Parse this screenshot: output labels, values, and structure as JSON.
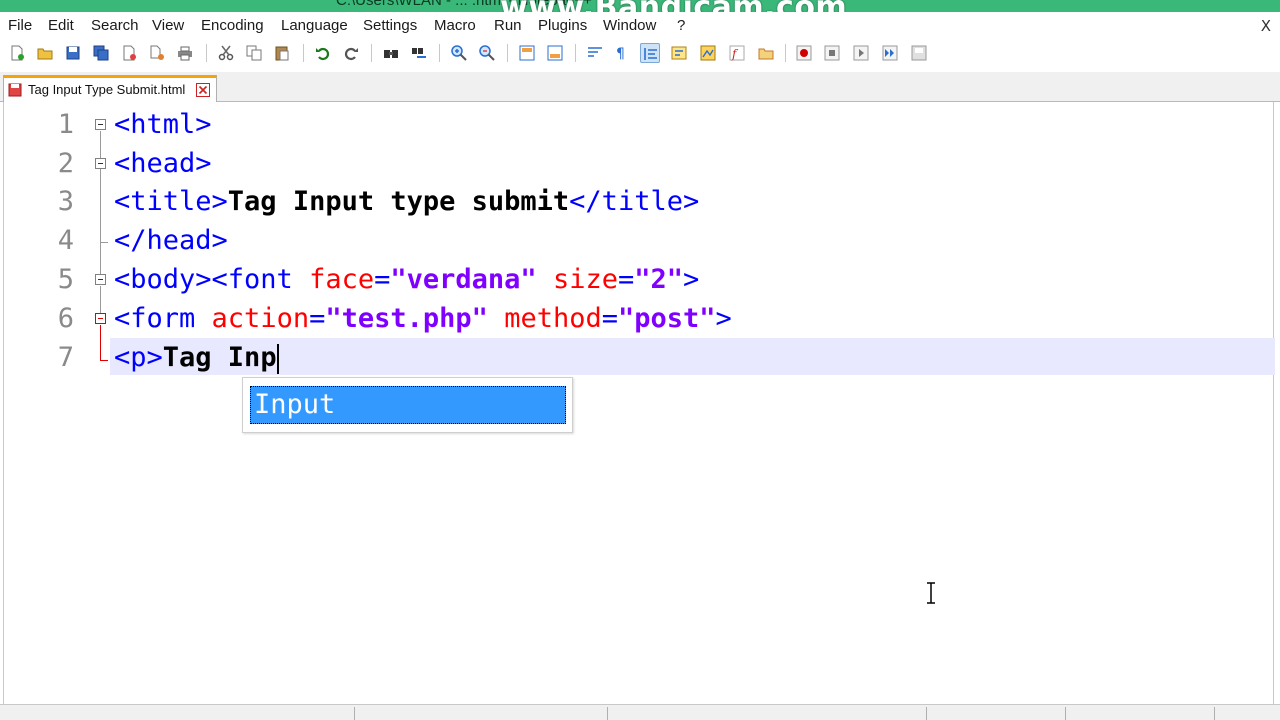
{
  "window": {
    "title": "C:\\Users\\WLAN - ... .html - Notepad++",
    "watermark": "www.Bandicam.com"
  },
  "menu": {
    "items": [
      "File",
      "Edit",
      "Search",
      "View",
      "Encoding",
      "Language",
      "Settings",
      "Macro",
      "Run",
      "Plugins",
      "Window",
      "?"
    ],
    "close_label": "X"
  },
  "toolbar": {
    "icons": [
      "new-file-icon",
      "open-file-icon",
      "save-icon",
      "save-all-icon",
      "close-icon",
      "close-all-icon",
      "print-icon",
      "cut-icon",
      "copy-icon",
      "paste-icon",
      "undo-icon",
      "redo-icon",
      "find-icon",
      "replace-icon",
      "zoom-in-icon",
      "zoom-out-icon",
      "sync-vertical-icon",
      "sync-horizontal-icon",
      "word-wrap-icon",
      "show-all-characters-icon",
      "indent-guide-icon",
      "user-language-icon",
      "doc-map-icon",
      "function-list-icon",
      "folder-workspace-icon",
      "record-macro-icon",
      "stop-record-icon",
      "playback-macro-icon",
      "run-macro-multiple-icon",
      "save-macro-icon"
    ]
  },
  "tab": {
    "label": "Tag Input Type Submit.html",
    "accent_color": "#f4a30b"
  },
  "editor": {
    "lines": [
      {
        "no": "1",
        "segments": [
          {
            "cls": "t-tag",
            "text": "<html>"
          }
        ]
      },
      {
        "no": "2",
        "segments": [
          {
            "cls": "t-tag",
            "text": "<head>"
          }
        ]
      },
      {
        "no": "3",
        "segments": [
          {
            "cls": "t-tag",
            "text": "<title>"
          },
          {
            "cls": "t-text",
            "text": "Tag Input type submit"
          },
          {
            "cls": "t-tag",
            "text": "</title>"
          }
        ]
      },
      {
        "no": "4",
        "segments": [
          {
            "cls": "t-tag",
            "text": "</head>"
          }
        ]
      },
      {
        "no": "5",
        "segments": [
          {
            "cls": "t-tag",
            "text": "<body><font "
          },
          {
            "cls": "t-attr",
            "text": "face"
          },
          {
            "cls": "t-tag",
            "text": "="
          },
          {
            "cls": "t-str",
            "text": "\"verdana\""
          },
          {
            "cls": "t-tag",
            "text": " "
          },
          {
            "cls": "t-attr",
            "text": "size"
          },
          {
            "cls": "t-tag",
            "text": "="
          },
          {
            "cls": "t-str",
            "text": "\"2\""
          },
          {
            "cls": "t-tag",
            "text": ">"
          }
        ]
      },
      {
        "no": "6",
        "segments": [
          {
            "cls": "t-tag",
            "text": "<form "
          },
          {
            "cls": "t-attr",
            "text": "action"
          },
          {
            "cls": "t-tag",
            "text": "="
          },
          {
            "cls": "t-str",
            "text": "\"test.php\""
          },
          {
            "cls": "t-tag",
            "text": " "
          },
          {
            "cls": "t-attr",
            "text": "method"
          },
          {
            "cls": "t-tag",
            "text": "="
          },
          {
            "cls": "t-str",
            "text": "\"post\""
          },
          {
            "cls": "t-tag",
            "text": ">"
          }
        ]
      },
      {
        "no": "7",
        "segments": [
          {
            "cls": "t-tag",
            "text": "<p>"
          },
          {
            "cls": "t-text",
            "text": "Tag Inp"
          }
        ]
      }
    ],
    "current_line": 7,
    "colors": {
      "tag": "#0000ff",
      "attribute": "#ff0000",
      "string": "#8000ff",
      "current_line_bg": "#e8e8ff"
    }
  },
  "autocomplete": {
    "items": [
      "Input"
    ],
    "selected_bg": "#3399ff"
  }
}
